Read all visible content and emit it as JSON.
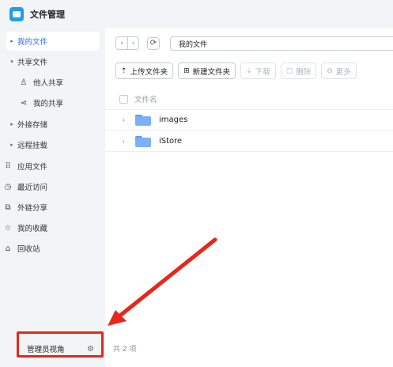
{
  "app": {
    "title": "文件管理"
  },
  "sidebar": {
    "items": [
      {
        "label": "我的文件",
        "icon": "caret-right",
        "active": true
      },
      {
        "label": "共享文件",
        "icon": "caret-down"
      },
      {
        "label": "他人共享",
        "icon": "people-icon",
        "sub": true
      },
      {
        "label": "我的共享",
        "icon": "share-icon",
        "sub": true
      },
      {
        "label": "外接存储",
        "icon": "caret-right"
      },
      {
        "label": "远程挂载",
        "icon": "caret-right"
      },
      {
        "label": "应用文件",
        "icon": "apps-icon"
      },
      {
        "label": "最近访问",
        "icon": "clock-icon"
      },
      {
        "label": "外链分享",
        "icon": "external-link-icon"
      },
      {
        "label": "我的收藏",
        "icon": "star-icon"
      },
      {
        "label": "回收站",
        "icon": "trash-icon"
      }
    ],
    "admin_view": "管理员视角"
  },
  "nav": {
    "back": "‹",
    "forward": "›",
    "refresh": "⟳",
    "path": "我的文件"
  },
  "toolbar": {
    "upload": "上传文件夹",
    "new_folder": "新建文件夹",
    "download": "下载",
    "delete": "删除",
    "more": "更多"
  },
  "list": {
    "header": "文件名",
    "rows": [
      {
        "name": "images"
      },
      {
        "name": "iStore"
      }
    ],
    "count_text": "共 2 项"
  },
  "colors": {
    "accent": "#2f6bff",
    "highlight": "#e8261a",
    "folder": "#79b0f7"
  }
}
